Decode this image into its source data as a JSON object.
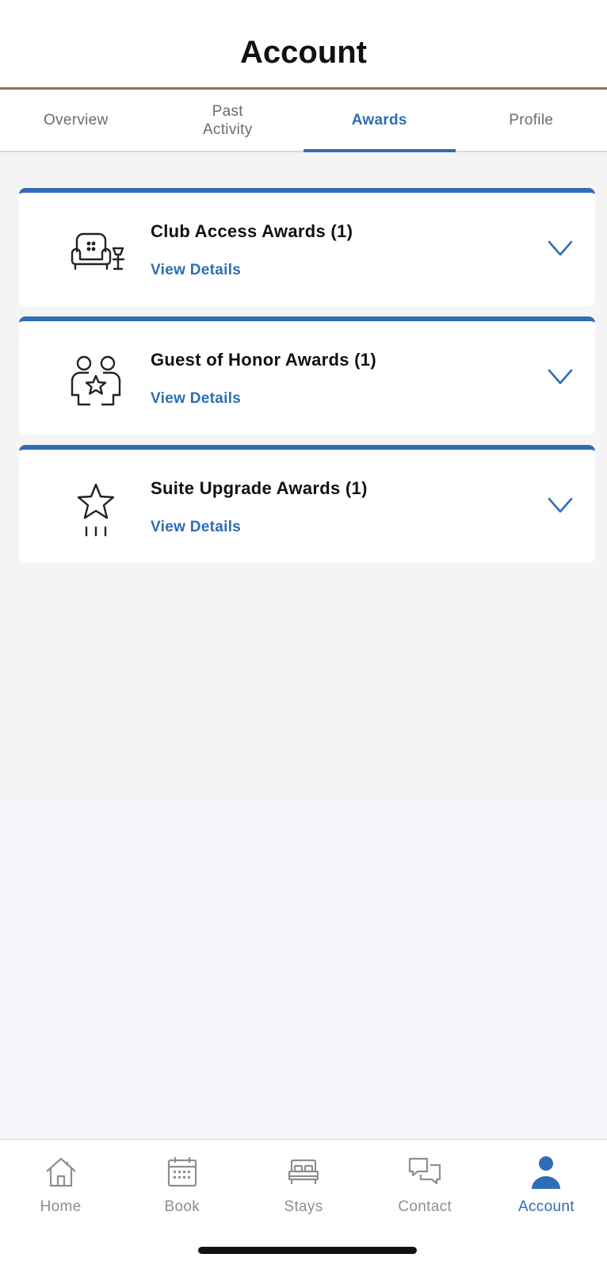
{
  "header": {
    "title": "Account"
  },
  "tabs": [
    {
      "label": "Overview",
      "active": false
    },
    {
      "label": "Past\nActivity",
      "active": false
    },
    {
      "label": "Awards",
      "active": true
    },
    {
      "label": "Profile",
      "active": false
    }
  ],
  "awards": [
    {
      "title": "Club Access Awards (1)",
      "link": "View Details",
      "icon": "lounge-chair-icon"
    },
    {
      "title": "Guest of Honor Awards (1)",
      "link": "View Details",
      "icon": "guests-star-icon"
    },
    {
      "title": "Suite Upgrade Awards (1)",
      "link": "View Details",
      "icon": "star-upgrade-icon"
    }
  ],
  "bottom_nav": [
    {
      "label": "Home",
      "icon": "home-icon",
      "active": false
    },
    {
      "label": "Book",
      "icon": "calendar-icon",
      "active": false
    },
    {
      "label": "Stays",
      "icon": "bed-icon",
      "active": false
    },
    {
      "label": "Contact",
      "icon": "chat-icon",
      "active": false
    },
    {
      "label": "Account",
      "icon": "person-icon",
      "active": true
    }
  ],
  "colors": {
    "accent": "#2f6db5",
    "header_border": "#8a7466",
    "background": "#f4f4f5"
  }
}
